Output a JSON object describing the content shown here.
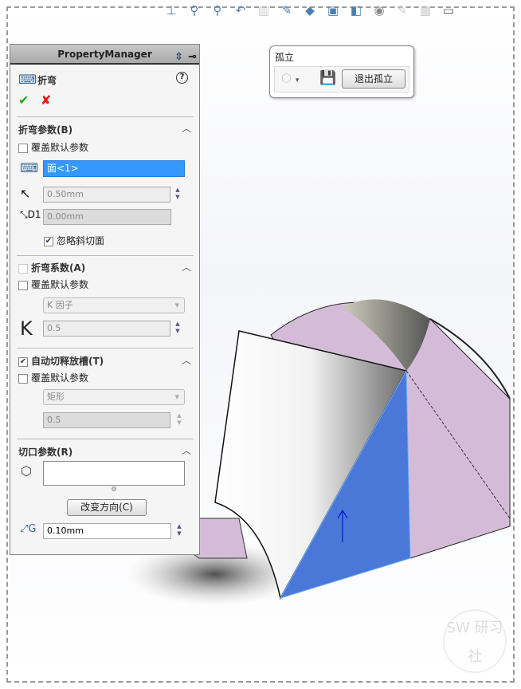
{
  "toolbar": {
    "icons": [
      "view-orientation-icon",
      "zoom-to-fit-icon",
      "zoom-area-icon",
      "previous-view-icon",
      "section-view-icon",
      "dynamic-annotation-icon",
      "view-cube-icon",
      "display-style-icon",
      "hide-show-icon",
      "edit-appearance-icon",
      "apply-scene-icon",
      "view-settings-icon",
      "display-monitor-icon"
    ]
  },
  "property_manager": {
    "title": "PropertyManager",
    "feature_name": "折弯",
    "bend_params": {
      "header": "折弯参数(B)",
      "override": "覆盖默认参数",
      "face_selection": "面<1>",
      "radius": "0.50mm",
      "distance": "0.00mm",
      "ignore_bevel": "忽略斜切面"
    },
    "bend_allowance": {
      "header": "折弯系数(A)",
      "override": "覆盖默认参数",
      "type": "K 因子",
      "k_value": "0.5",
      "k_label": "K"
    },
    "auto_relief": {
      "header": "自动切释放槽(T)",
      "override": "覆盖默认参数",
      "type": "矩形",
      "ratio": "0.5"
    },
    "rip_params": {
      "header": "切口参数(R)",
      "edges": "",
      "reverse_button": "改变方向(C)",
      "gap": "0.10mm"
    }
  },
  "isolate": {
    "title": "孤立",
    "exit_button": "退出孤立"
  },
  "watermark": {
    "text": "SW 研习社"
  },
  "colors": {
    "selected_face": "#4a78d8",
    "part_face": "#d4bcd8",
    "accent": "#3399ff"
  }
}
